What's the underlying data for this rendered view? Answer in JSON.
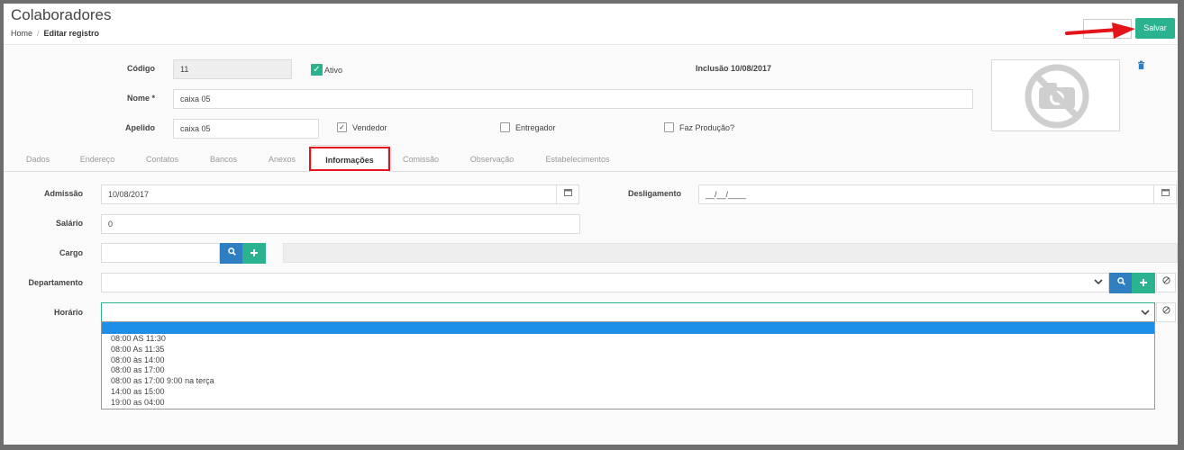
{
  "header": {
    "title": "Colaboradores",
    "breadcrumb_home": "Home",
    "breadcrumb_sep": "/",
    "breadcrumb_current": "Editar registro",
    "save_label": "Salvar"
  },
  "form": {
    "codigo_label": "Código",
    "codigo_value": "11",
    "ativo_label": "Ativo",
    "inclusao_text": "Inclusão 10/08/2017",
    "nome_label": "Nome *",
    "nome_value": "caixa 05",
    "apelido_label": "Apelido",
    "apelido_value": "caixa 05",
    "vendedor_label": "Vendedor",
    "entregador_label": "Entregador",
    "faz_producao_label": "Faz Produção?"
  },
  "tabs": [
    {
      "label": "Dados"
    },
    {
      "label": "Endereço"
    },
    {
      "label": "Contatos"
    },
    {
      "label": "Bancos"
    },
    {
      "label": "Anexos"
    },
    {
      "label": "Informações"
    },
    {
      "label": "Comissão"
    },
    {
      "label": "Observação"
    },
    {
      "label": "Estabelecimentos"
    }
  ],
  "info": {
    "admissao_label": "Admissão",
    "admissao_value": "10/08/2017",
    "desligamento_label": "Desligamento",
    "desligamento_value": "__/__/____",
    "salario_label": "Salário",
    "salario_value": "0",
    "cargo_label": "Cargo",
    "departamento_label": "Departamento",
    "horario_label": "Horário"
  },
  "horario_options": [
    "08:00 AS 11:30",
    "08:00 As 11:35",
    "08:00 às 14:00",
    "08:00 as 17:00",
    "08:00 as 17:00 9:00 na terça",
    "14:00 as 15:00",
    "19:00 as 04:00"
  ],
  "colors": {
    "accent_green": "#2bb38f",
    "accent_blue": "#2f7ec2",
    "highlight_red": "#e4141b",
    "dropdown_selected": "#1e8fe8"
  },
  "icons": {
    "calendar": "calendar-icon",
    "search": "search-icon",
    "plus": "plus-icon",
    "clear": "clear-icon",
    "chevron": "chevron-down-icon",
    "trash": "trash-icon",
    "no_photo": "no-photo-icon"
  }
}
